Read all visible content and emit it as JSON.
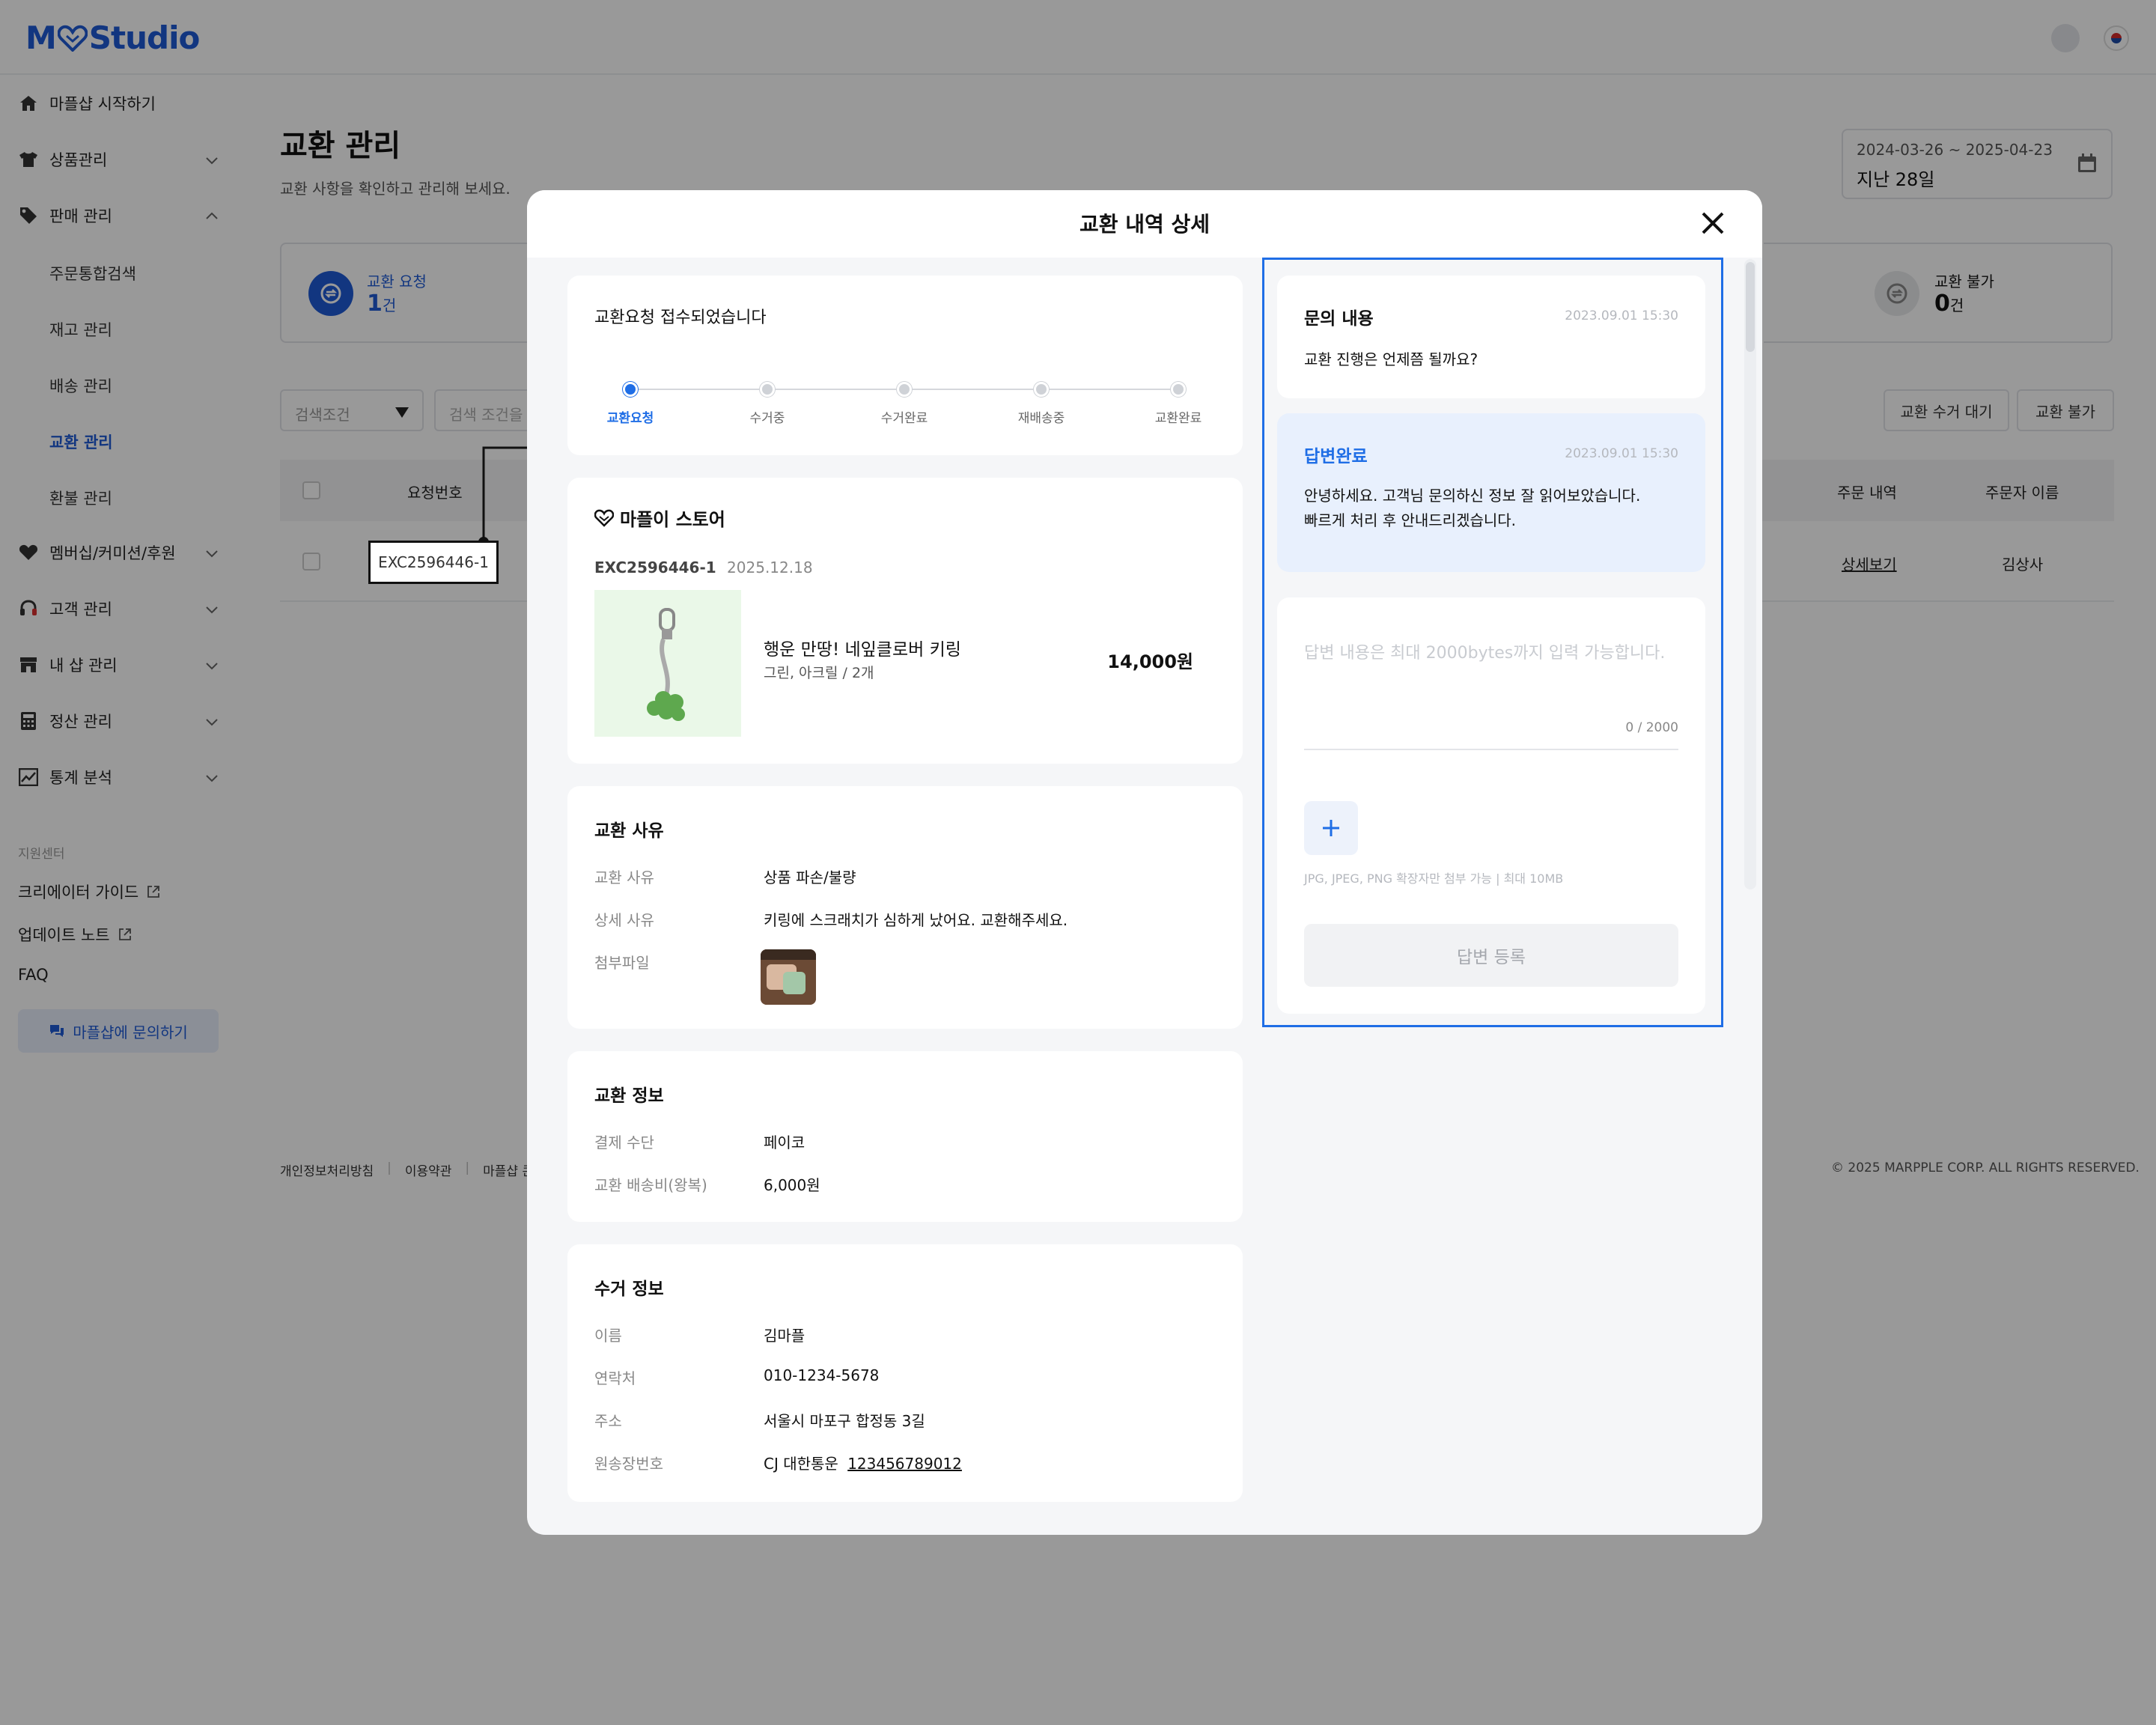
{
  "app": {
    "logo_text_left": "M",
    "logo_text_right": "Studio"
  },
  "sidebar": {
    "items": [
      {
        "label": "마플샵 시작하기"
      },
      {
        "label": "상품관리"
      },
      {
        "label": "판매 관리"
      },
      {
        "label": "멤버십/커미션/후원"
      },
      {
        "label": "고객 관리"
      },
      {
        "label": "내 샵 관리"
      },
      {
        "label": "정산 관리"
      },
      {
        "label": "통계 분석"
      }
    ],
    "subitems": [
      {
        "label": "주문통합검색"
      },
      {
        "label": "재고 관리"
      },
      {
        "label": "배송 관리"
      },
      {
        "label": "교환 관리"
      },
      {
        "label": "환불 관리"
      }
    ],
    "support_label": "지원센터",
    "links": [
      {
        "label": "크리에이터 가이드"
      },
      {
        "label": "업데이트 노트"
      },
      {
        "label": "FAQ"
      }
    ],
    "cta": "마플샵에 문의하기"
  },
  "page": {
    "title": "교환 관리",
    "subtitle": "교환 사항을 확인하고 관리해 보세요.",
    "date_range": "2024-03-26 ~ 2025-04-23",
    "date_label": "지난 28일"
  },
  "stats": {
    "request_label": "교환 요청",
    "request_value": "1",
    "request_unit": "건",
    "reject_label": "교환 불가",
    "reject_value": "0",
    "reject_unit": "건"
  },
  "filters": {
    "select_placeholder": "검색조건",
    "input_placeholder": "검색 조건을 선",
    "btn_wait": "교환 수거 대기",
    "btn_reject": "교환 불가"
  },
  "table": {
    "headers": {
      "request_no": "요청번호",
      "order": "주문 내역",
      "orderer": "주문자 이름"
    },
    "row": {
      "request_no": "EXC2596446-1",
      "order_link": "상세보기",
      "orderer": "김상사"
    }
  },
  "footer": {
    "links": [
      "개인정보처리방침",
      "이용약관",
      "마플샵 콘텐"
    ],
    "copyright": "© 2025 MARPPLE CORP. ALL RIGHTS RESERVED."
  },
  "modal": {
    "title": "교환 내역 상세",
    "status_title": "교환요청 접수되었습니다",
    "steps": [
      "교환요청",
      "수거중",
      "수거완료",
      "재배송중",
      "교환완료"
    ],
    "store": {
      "name": "마플이 스토어",
      "order_no": "EXC2596446-1",
      "order_date": "2025.12.18",
      "product_name": "행운 만땅! 네잎클로버 키링",
      "product_option": "그린, 아크릴 / 2개",
      "price": "14,000원"
    },
    "reason": {
      "title": "교환 사유",
      "label_reason": "교환 사유",
      "value_reason": "상품 파손/불량",
      "label_detail": "상세 사유",
      "value_detail": "키링에 스크래치가 심하게 났어요. 교환해주세요.",
      "label_file": "첨부파일"
    },
    "exchange_info": {
      "title": "교환 정보",
      "label_payment": "결제 수단",
      "value_payment": "페이코",
      "label_fee": "교환 배송비(왕복)",
      "value_fee": "6,000원"
    },
    "pickup": {
      "title": "수거 정보",
      "label_name": "이름",
      "value_name": "김마플",
      "label_phone": "연락처",
      "value_phone": "010-1234-5678",
      "label_address": "주소",
      "value_address": "서울시 마포구 합정동 3길",
      "label_tracking": "원송장번호",
      "value_courier": "CJ 대한통운",
      "value_tracking": "123456789012"
    },
    "inquiry": {
      "title": "문의 내용",
      "date": "2023.09.01 15:30",
      "body": "교환 진행은 언제쯤 될까요?"
    },
    "answer": {
      "title": "답변완료",
      "date": "2023.09.01 15:30",
      "line1": "안녕하세요. 고객님 문의하신 정보 잘 읽어보았습니다.",
      "line2": "빠르게 처리 후 안내드리겠습니다."
    },
    "reply": {
      "placeholder": "답변 내용은 최대 2000bytes까지 입력 가능합니다.",
      "counter": "0 / 2000",
      "attach_note": "JPG, JPEG, PNG 확장자만 첨부 가능  |  최대 10MB",
      "submit": "답변 등록"
    }
  },
  "colors": {
    "accent": "#1f6ee6",
    "brand": "#1f5bd6",
    "overlay": "rgba(0,0,0,0.40)"
  }
}
